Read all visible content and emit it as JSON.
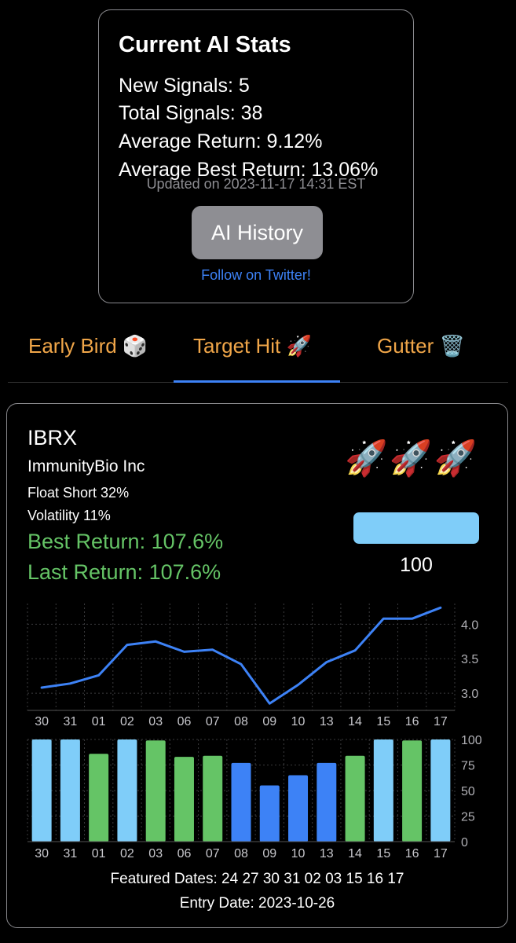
{
  "stats": {
    "title": "Current AI Stats",
    "new_signals": "New Signals: 5",
    "total_signals": "Total Signals: 38",
    "average_return": "Average Return: 9.12%",
    "average_best_return": "Average Best Return: 13.06%",
    "updated": "Updated on 2023-11-17 14:31 EST",
    "history_button": "AI History",
    "twitter_link": "Follow on Twitter!"
  },
  "tabs": [
    {
      "label": "Early Bird 🎲"
    },
    {
      "label": "Target Hit 🚀"
    },
    {
      "label": "Gutter 🗑️"
    }
  ],
  "active_tab": "Target Hit 🚀",
  "signal": {
    "ticker": "IBRX",
    "company": "ImmunityBio Inc",
    "float_short": "Float Short 32%",
    "volatility": "Volatility 11%",
    "best_return": "Best Return: 107.6%",
    "last_return": "Last Return: 107.6%",
    "rockets": "🚀🚀🚀",
    "score": "100",
    "score_value": 100,
    "featured_dates": "Featured Dates:   24  27  30  31  02  03  15  16  17",
    "entry_date": "Entry Date: 2023-10-26"
  },
  "colors": {
    "accent_blue": "#3d82f6",
    "light_blue": "#7fcdf9",
    "green": "#65c466",
    "tab_orange": "#f0a649",
    "gray_button": "#8e8e93"
  },
  "chart_data": [
    {
      "type": "line",
      "x": [
        "30",
        "31",
        "01",
        "02",
        "03",
        "06",
        "07",
        "08",
        "09",
        "10",
        "13",
        "14",
        "15",
        "16",
        "17"
      ],
      "values": [
        3.08,
        3.14,
        3.26,
        3.7,
        3.75,
        3.6,
        3.63,
        3.42,
        2.85,
        3.12,
        3.45,
        3.62,
        4.08,
        4.08,
        4.24
      ],
      "yticks": [
        "3.0",
        "3.5",
        "4.0"
      ],
      "ylim": [
        2.75,
        4.3
      ],
      "grid": true,
      "color": "#3d82f6"
    },
    {
      "type": "bar",
      "categories": [
        "30",
        "31",
        "01",
        "02",
        "03",
        "06",
        "07",
        "08",
        "09",
        "10",
        "13",
        "14",
        "15",
        "16",
        "17"
      ],
      "values": [
        100,
        100,
        86,
        100,
        99,
        83,
        84,
        77,
        55,
        65,
        77,
        84,
        100,
        99,
        100
      ],
      "colors": [
        "#7fcdf9",
        "#7fcdf9",
        "#65c466",
        "#7fcdf9",
        "#65c466",
        "#65c466",
        "#65c466",
        "#3d82f6",
        "#3d82f6",
        "#3d82f6",
        "#3d82f6",
        "#65c466",
        "#7fcdf9",
        "#65c466",
        "#7fcdf9"
      ],
      "yticks": [
        "0",
        "25",
        "50",
        "75",
        "100"
      ],
      "ylim": [
        0,
        100
      ],
      "grid": true
    }
  ]
}
